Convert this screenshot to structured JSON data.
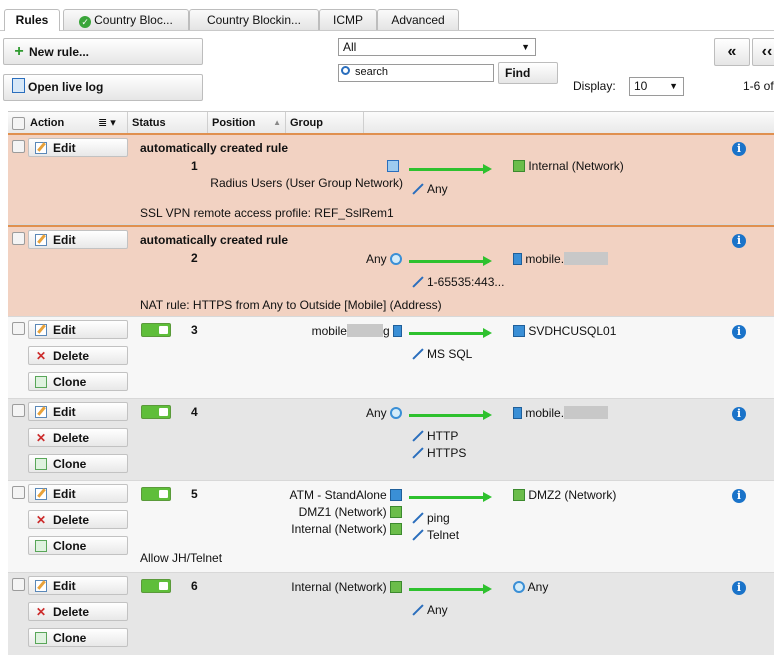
{
  "tabs": [
    {
      "label": "Rules"
    },
    {
      "label": "Country Bloc..."
    },
    {
      "label": "Country Blockin..."
    },
    {
      "label": "ICMP"
    },
    {
      "label": "Advanced"
    }
  ],
  "toolbar": {
    "new_rule": "New rule...",
    "open_live_log": "Open live log",
    "filter_value": "All",
    "search_placeholder": "search",
    "find": "Find",
    "display_label": "Display:",
    "display_value": "10",
    "range_text": "1-6 of",
    "first_page": "«"
  },
  "columns": {
    "action": "Action",
    "status": "Status",
    "position": "Position",
    "group": "Group"
  },
  "buttons": {
    "edit": "Edit",
    "delete": "Delete",
    "clone": "Clone"
  },
  "rules": [
    {
      "position": "1",
      "title": "automatically created rule",
      "sources": [
        "Radius Users (User Group Network)"
      ],
      "services": [
        "Any"
      ],
      "destination": "Internal (Network)",
      "comment": "SSL VPN remote access profile: REF_SslRem1"
    },
    {
      "position": "2",
      "title": "automatically created rule",
      "sources": [
        "Any"
      ],
      "services": [
        "1-65535:443..."
      ],
      "destination": "mobile.",
      "comment": "NAT rule: HTTPS from Any to Outside [Mobile] (Address)"
    },
    {
      "position": "3",
      "sources": [
        "mobile",
        "g"
      ],
      "services": [
        "MS SQL"
      ],
      "destination": "SVDHCUSQL01"
    },
    {
      "position": "4",
      "sources": [
        "Any"
      ],
      "services": [
        "HTTP",
        "HTTPS"
      ],
      "destination": "mobile."
    },
    {
      "position": "5",
      "sources": [
        "ATM - StandAlone",
        "DMZ1 (Network)",
        "Internal (Network)"
      ],
      "services": [
        "ping",
        "Telnet"
      ],
      "destination": "DMZ2 (Network)",
      "comment": "Allow JH/Telnet"
    },
    {
      "position": "6",
      "sources": [
        "Internal (Network)"
      ],
      "services": [
        "Any"
      ],
      "destination": "Any"
    }
  ],
  "icons": {
    "info": "i"
  }
}
